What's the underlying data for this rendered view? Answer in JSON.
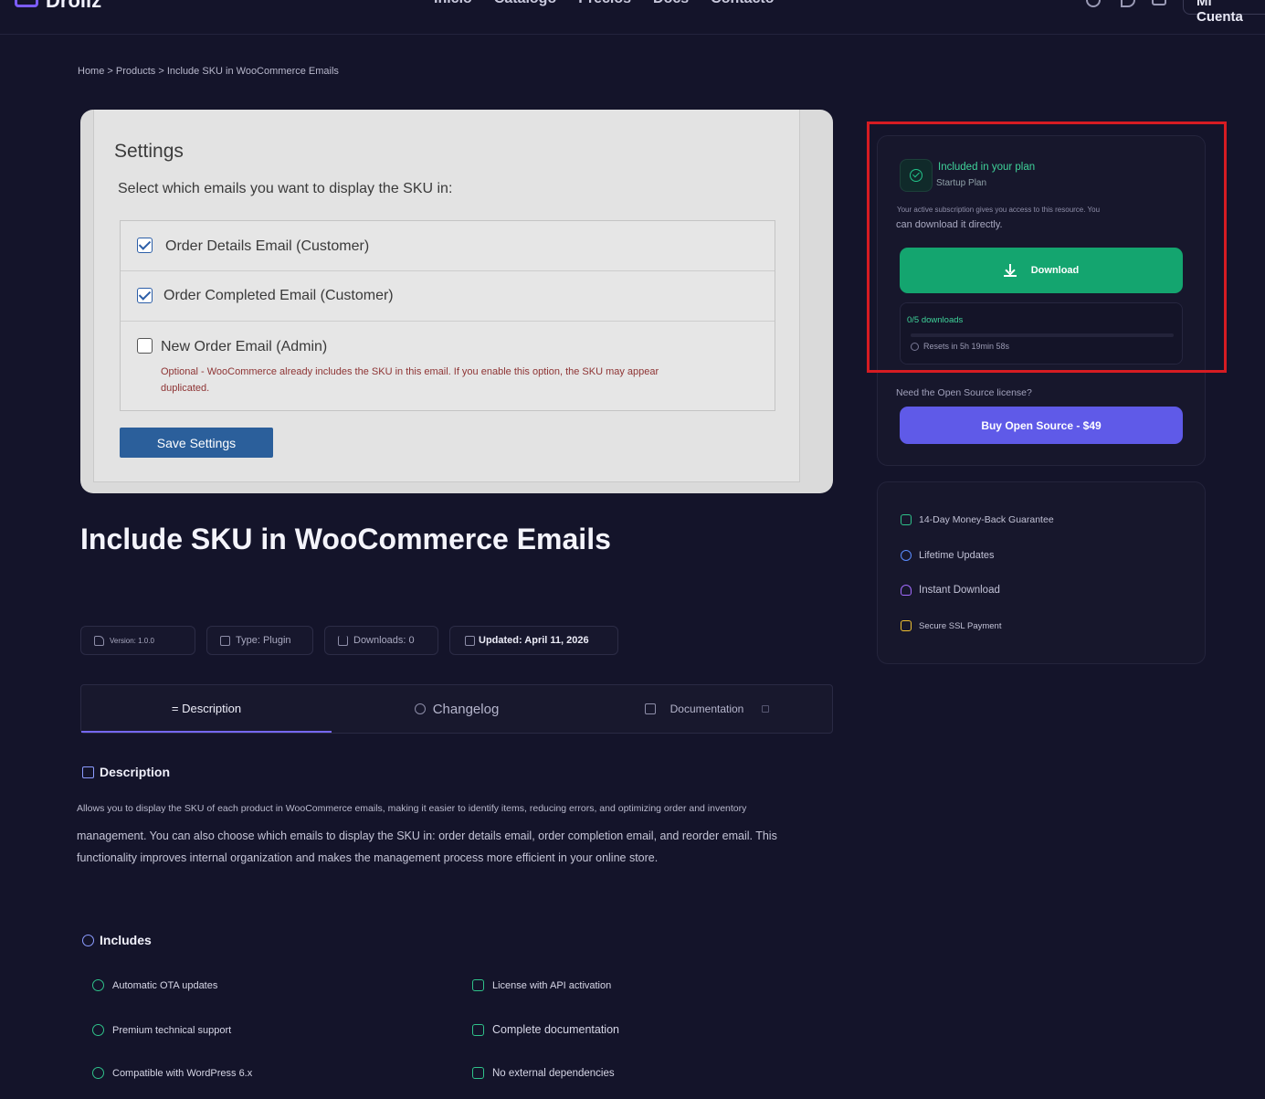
{
  "nav": {
    "brand": "Drollz",
    "links": [
      "Inicio",
      "Catalogo",
      "Precios",
      "Docs",
      "Contacto"
    ],
    "account_label": "Mi Cuenta"
  },
  "breadcrumb": "Home > Products > Include SKU in WooCommerce Emails",
  "hero": {
    "title": "Settings",
    "subtitle": "Select which emails you want to display the SKU in:",
    "options": [
      {
        "label": "Order Details Email (Customer)",
        "checked": true
      },
      {
        "label": "Order Completed Email (Customer)",
        "checked": true
      },
      {
        "label": "New Order Email (Admin)",
        "checked": false
      }
    ],
    "note": "Optional - WooCommerce already includes the SKU in this email. If you enable this option, the SKU may appear duplicated.",
    "save_label": "Save Settings"
  },
  "product": {
    "title": "Include SKU in WooCommerce Emails",
    "version": "Version: 1.0.0",
    "type": "Type: Plugin",
    "downloads": "Downloads: 0",
    "updated": "Updated: April 11, 2026"
  },
  "tabs": {
    "description": "= Description",
    "changelog": "Changelog",
    "documentation": "Documentation"
  },
  "description": {
    "heading": "Description",
    "p1": "Allows you to display the SKU of each product in WooCommerce emails, making it easier to identify items, reducing errors, and optimizing order and inventory",
    "p2": "management. You can also choose which emails to display the SKU in: order details email, order completion email, and reorder email. This functionality improves internal organization and makes the management process more efficient in your online store."
  },
  "includes": {
    "heading": "Includes",
    "items": [
      "Automatic OTA updates",
      "License with API activation",
      "Premium technical support",
      "Complete documentation",
      "Compatible with WordPress 6.x",
      "No external dependencies"
    ]
  },
  "plan": {
    "title": "Included in your plan",
    "plan_name": "Startup Plan",
    "note_line1": "Your active subscription gives you access to this resource. You",
    "note_line2": "can download it directly.",
    "download_label": "Download",
    "downloads_used": "0/5 downloads",
    "downloads_fraction": 0,
    "reset_text": "Resets in 5h 19min 58s",
    "open_source_question": "Need the Open Source license?",
    "open_source_button": "Buy Open Source - $49",
    "accent_green": "#14a56f",
    "accent_purple": "#5f5ae8"
  },
  "features": [
    "14-Day Money-Back Guarantee",
    "Lifetime Updates",
    "Instant Download",
    "Secure SSL Payment"
  ]
}
